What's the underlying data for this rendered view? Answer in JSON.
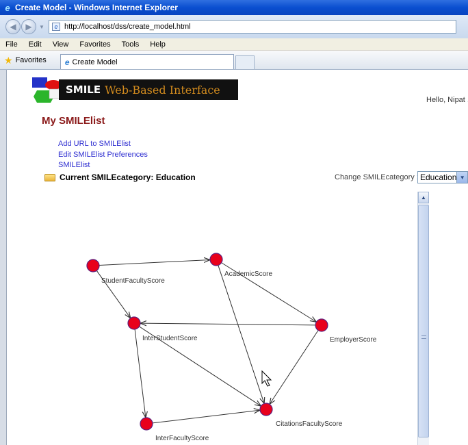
{
  "window": {
    "title": "Create Model - Windows Internet Explorer"
  },
  "browser": {
    "url": "http://localhost/dss/create_model.html",
    "menu": [
      "File",
      "Edit",
      "View",
      "Favorites",
      "Tools",
      "Help"
    ],
    "favorites_label": "Favorites",
    "tab_label": "Create Model"
  },
  "page": {
    "banner": {
      "brand": "SMILE",
      "subtitle": "Web-Based Interface"
    },
    "greeting": "Hello, Nipat .",
    "heading": "My SMILElist",
    "links": [
      "Add URL to SMILElist",
      "Edit SMILElist Preferences",
      "SMILElist"
    ],
    "current_category": "Current SMILEcategory: Education",
    "change_category_label": "Change SMILEcategory :",
    "category_select": "Education"
  },
  "graph": {
    "node_color": "#e8001c",
    "nodes": [
      {
        "id": "StudentFacultyScore",
        "label": "StudentFacultyScore"
      },
      {
        "id": "AcademicScore",
        "label": "AcademicScore"
      },
      {
        "id": "InterStudentScore",
        "label": "InterStudentScore"
      },
      {
        "id": "EmployerScore",
        "label": "EmployerScore"
      },
      {
        "id": "InterFacultyScore",
        "label": "InterFacultyScore"
      },
      {
        "id": "CitationsFacultyScore",
        "label": "CitationsFacultyScore"
      }
    ],
    "edges": [
      [
        "StudentFacultyScore",
        "AcademicScore"
      ],
      [
        "StudentFacultyScore",
        "InterStudentScore"
      ],
      [
        "AcademicScore",
        "EmployerScore"
      ],
      [
        "AcademicScore",
        "CitationsFacultyScore"
      ],
      [
        "EmployerScore",
        "InterStudentScore"
      ],
      [
        "EmployerScore",
        "CitationsFacultyScore"
      ],
      [
        "InterStudentScore",
        "CitationsFacultyScore"
      ],
      [
        "InterStudentScore",
        "InterFacultyScore"
      ],
      [
        "InterFacultyScore",
        "CitationsFacultyScore"
      ]
    ]
  }
}
